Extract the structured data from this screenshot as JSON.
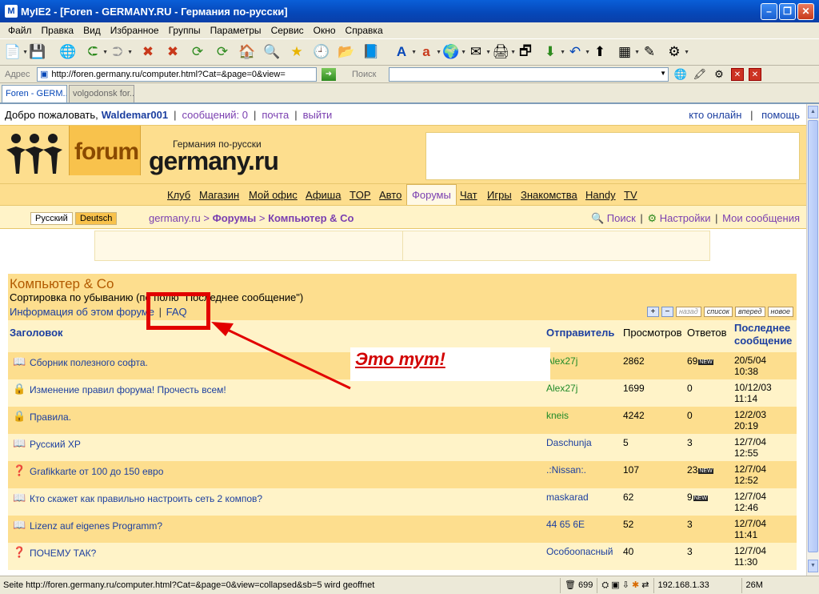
{
  "window": {
    "title": "MyIE2 - [Foren - GERMANY.RU - Германия по-русски]",
    "app_icon": "M"
  },
  "menu": [
    "Файл",
    "Правка",
    "Вид",
    "Избранное",
    "Группы",
    "Параметры",
    "Сервис",
    "Окно",
    "Справка"
  ],
  "addressbar": {
    "label": "Адрес",
    "url": "http://foren.germany.ru/computer.html?Cat=&page=0&view=",
    "search_label": "Поиск"
  },
  "tabs": [
    {
      "label": "Foren - GERM..."
    },
    {
      "label": "volgodonsk for..."
    }
  ],
  "site": {
    "welcome": "Добро пожаловать,",
    "username": "Waldemar001",
    "messages": "сообщений: 0",
    "mail": "почта",
    "logout": "выйти",
    "who_online": "кто онлайн",
    "help": "помощь",
    "logo_forum": "forum",
    "logo_sub": "Германия по-русски",
    "logo_main": "germany.ru",
    "nav": [
      {
        "label": "Клуб"
      },
      {
        "label": "Магазин"
      },
      {
        "label": "Мой офис"
      },
      {
        "label": "Афиша"
      },
      {
        "label": "TOP"
      },
      {
        "label": "Авто"
      },
      {
        "label": "Форумы"
      },
      {
        "label": "Чат"
      },
      {
        "label": "Игры"
      },
      {
        "label": "Знакомства"
      },
      {
        "label": "Handy"
      },
      {
        "label": "TV"
      }
    ],
    "lang_ru": "Русский",
    "lang_de": "Deutsch",
    "crumb_root": "germany.ru",
    "crumb_sep": ">",
    "crumb_forums": "Форумы",
    "crumb_current": "Компьютер & Co",
    "search": "Поиск",
    "settings": "Настройки",
    "my_messages": "Мои сообщения"
  },
  "forum": {
    "title": "Компьютер & Co",
    "sort": "Сортировка по убыванию (по полю \"Последнее сообщение\")",
    "info_link": "Информация об этом форуме",
    "faq_link": "FAQ",
    "tools": {
      "back": "назад",
      "list": "список",
      "forward": "вперед",
      "new": "новое"
    },
    "columns": {
      "title": "Заголовок",
      "author": "Отправитель",
      "views": "Просмотров",
      "answers": "Ответов",
      "last_1": "Последнее",
      "last_2": "сообщение"
    },
    "new_badge": "NEW",
    "rows": [
      {
        "icon": "book-icon",
        "title": "Сборник полезного софта.",
        "author": "Alex27j",
        "views": "2862",
        "answers": "69",
        "new": true,
        "date": "20/5/04",
        "time": "10:38"
      },
      {
        "icon": "lock-icon",
        "title": "Изменение правил форума! Прочесть всем!",
        "author": "Alex27j",
        "views": "1699",
        "answers": "0",
        "new": false,
        "date": "10/12/03",
        "time": "11:14"
      },
      {
        "icon": "lock-icon",
        "title": "Правила.",
        "author": "kneis",
        "views": "4242",
        "answers": "0",
        "new": false,
        "date": "12/2/03",
        "time": "20:19"
      },
      {
        "icon": "book-icon",
        "title": "Русский XP",
        "author": "Daschunja",
        "views": "5",
        "answers": "3",
        "new": false,
        "date": "12/7/04",
        "time": "12:55"
      },
      {
        "icon": "question-icon",
        "title": "Grafikkarte от 100 до 150 евро",
        "author": ".:Nissan:.",
        "views": "107",
        "answers": "23",
        "new": true,
        "date": "12/7/04",
        "time": "12:52"
      },
      {
        "icon": "book-icon",
        "title": "Кто скажет как правильно настроить сеть 2 компов?",
        "author": "maskarad",
        "views": "62",
        "answers": "9",
        "new": true,
        "date": "12/7/04",
        "time": "12:46"
      },
      {
        "icon": "book-icon",
        "title": "Lizenz auf eigenes Programm?",
        "author": "44 65 6E",
        "views": "52",
        "answers": "3",
        "new": false,
        "date": "12/7/04",
        "time": "11:41"
      },
      {
        "icon": "question-icon",
        "title": "ПОЧЕМУ ТАК?",
        "author": "Особоопасный",
        "views": "40",
        "answers": "3",
        "new": false,
        "date": "12/7/04",
        "time": "11:30"
      }
    ]
  },
  "annotation": {
    "label": "Это тут!"
  },
  "status": {
    "message": "Seite http://foren.germany.ru/computer.html?Cat=&page=0&view=collapsed&sb=5 wird geoffnet",
    "count": "699",
    "ip": "192.168.1.33",
    "memory": "26M"
  },
  "colors": {
    "accent_red": "#e20000",
    "header_yellow": "#fdde8e",
    "link_blue": "#1c3fa0",
    "link_purple": "#7a3fb0"
  }
}
